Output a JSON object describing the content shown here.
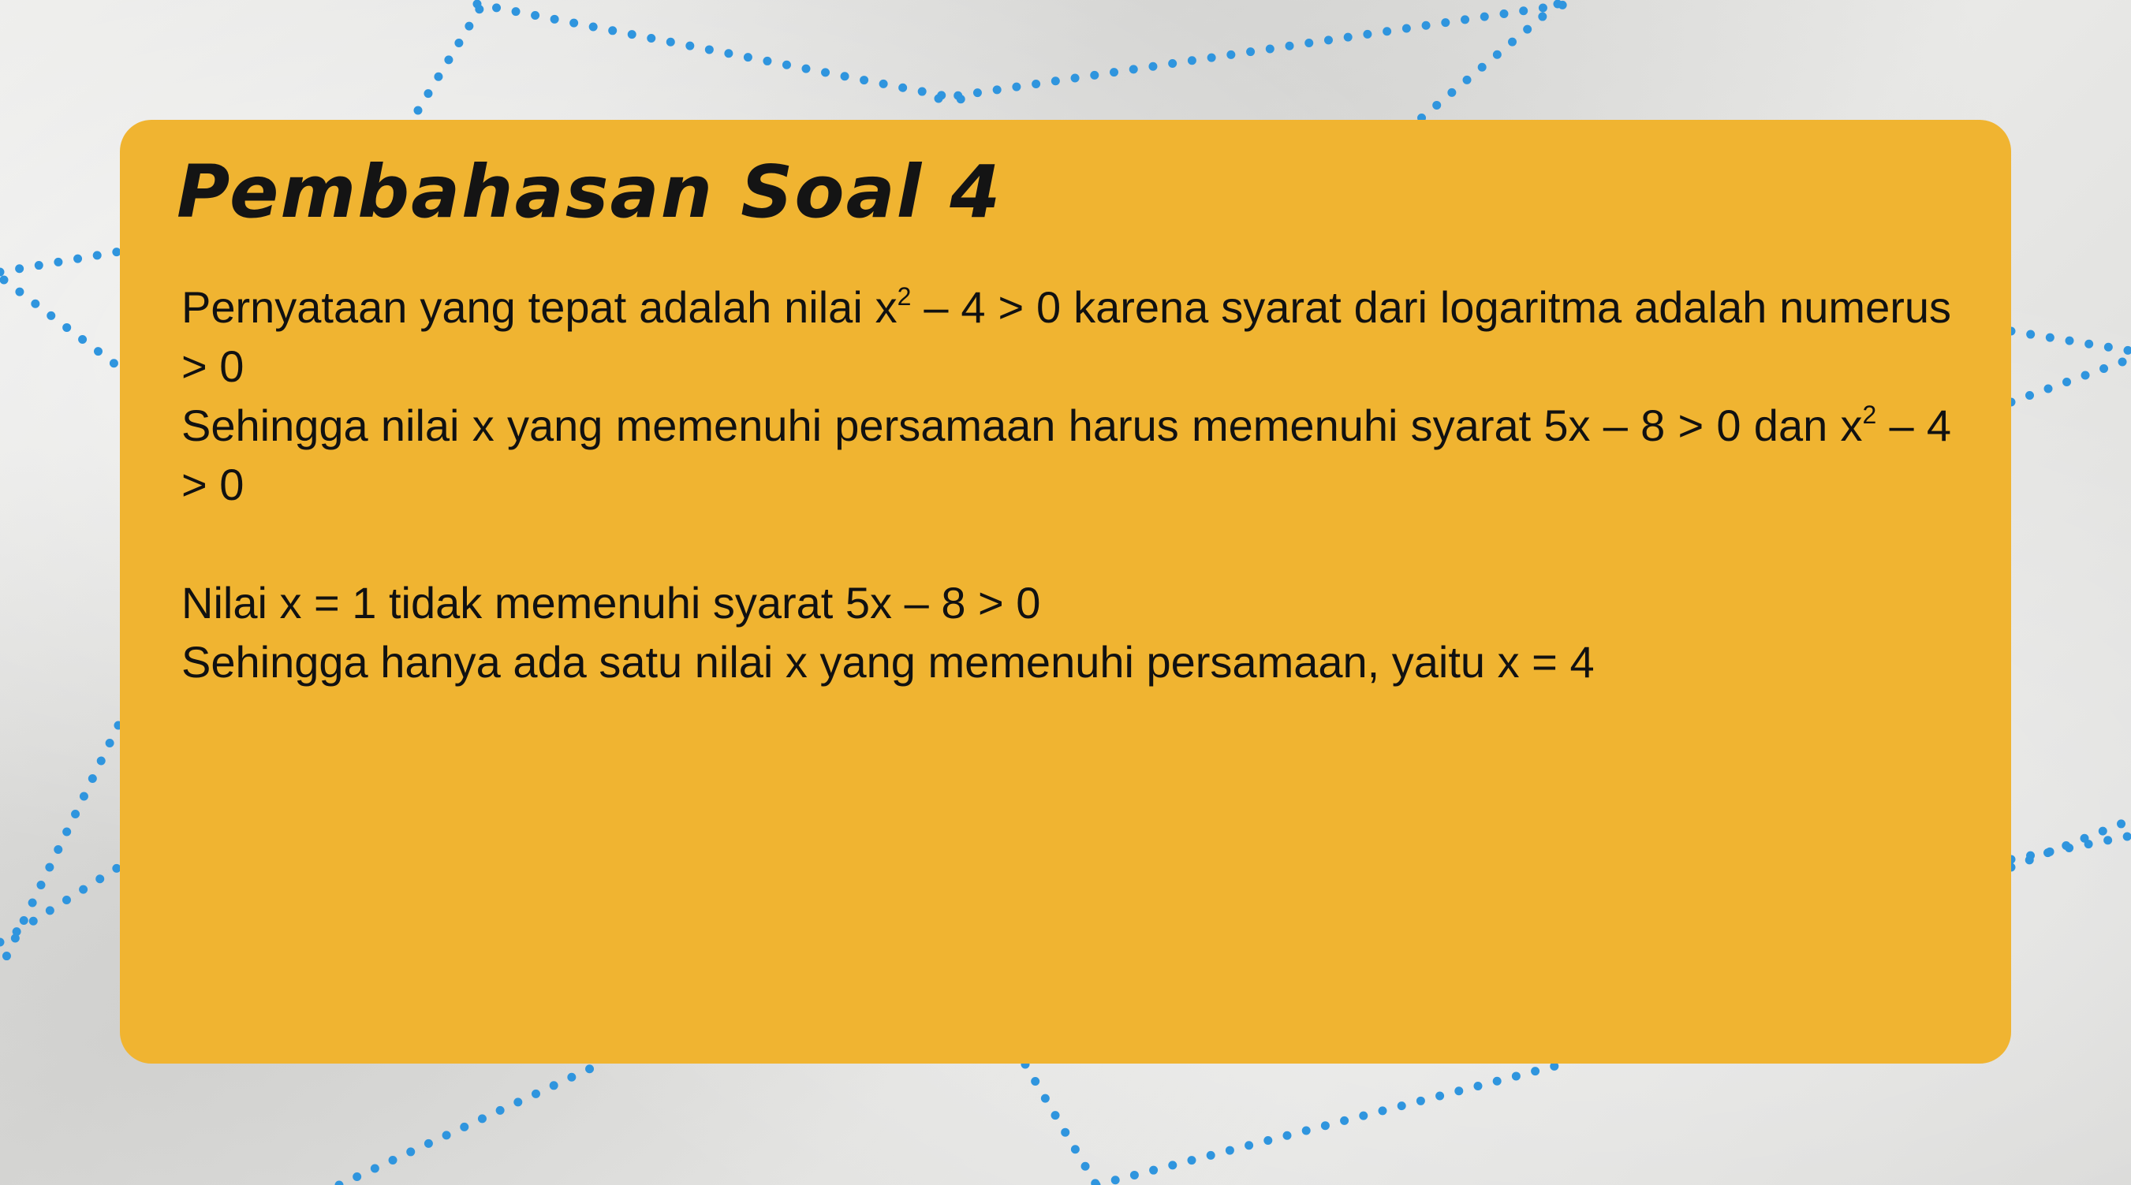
{
  "slide": {
    "title": "Pembahasan Soal 4",
    "colors": {
      "card": "#f0b431",
      "text": "#111111",
      "background": "#e6e6e4",
      "dots": "#2f95de"
    },
    "paragraph1": {
      "part_a": "Pernyataan yang tepat adalah nilai x",
      "sup": "2",
      "part_b": " – 4 > 0 karena syarat dari logaritma adalah numerus > 0"
    },
    "paragraph2": {
      "part_a": "Sehingga nilai x yang memenuhi persamaan harus memenuhi syarat 5x – 8 > 0 dan x",
      "sup": "2",
      "part_b": " – 4 > 0"
    },
    "line3": "Nilai x = 1 tidak memenuhi syarat 5x – 8 > 0",
    "line4": "Sehingga hanya ada satu nilai x yang memenuhi persamaan, yaitu x = 4"
  }
}
